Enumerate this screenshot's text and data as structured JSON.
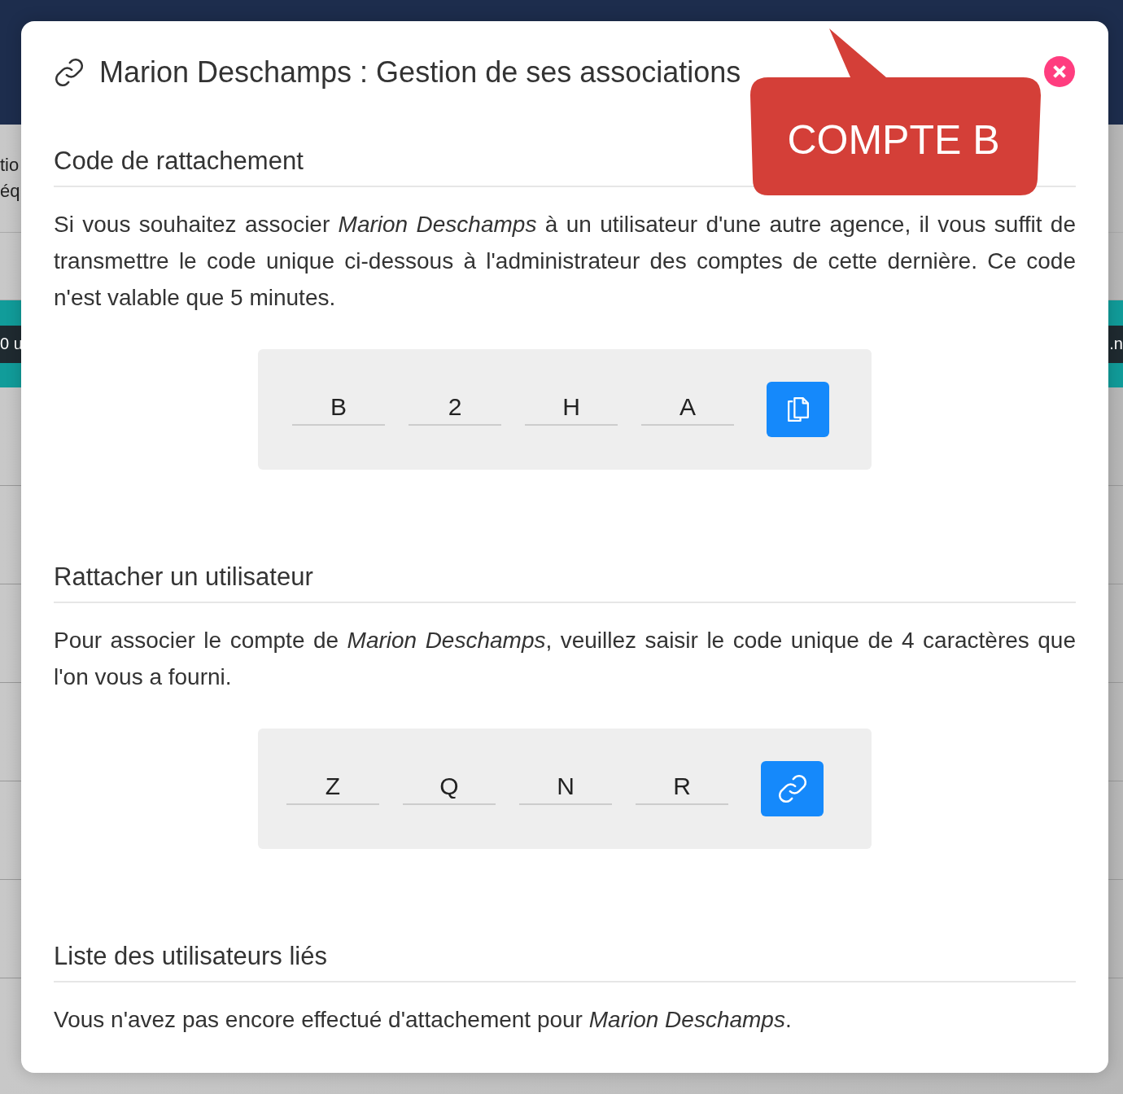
{
  "background_page": {
    "side_texts": [
      "tio",
      "éq"
    ],
    "bar_left_text": "0 u",
    "bar_right_text": ".n"
  },
  "modal": {
    "title": "Marion Deschamps : Gestion de ses associations",
    "close_button": {
      "kind": "close"
    },
    "callout": {
      "text": "COMPTE B"
    },
    "sections": [
      {
        "heading": "Code de rattachement",
        "paragraph": "Si vous souhaitez associer *Marion Deschamps* à un utilisateur d'une autre agence, il vous suffit de transmettre le code unique ci-dessous à l'administrateur des comptes de cette dernière. Ce code n'est valable que 5 minutes.",
        "code": {
          "kind": "display",
          "characters": [
            "B",
            "2",
            "H",
            "A"
          ],
          "button": {
            "kind": "copy"
          }
        }
      },
      {
        "heading": "Rattacher un utilisateur",
        "paragraph": "Pour associer le compte de *Marion Deschamps*, veuillez saisir le code unique de 4 caractères que l'on vous a fourni.",
        "code": {
          "kind": "input",
          "characters": [
            "Z",
            "Q",
            "N",
            "R"
          ],
          "button": {
            "kind": "link"
          }
        }
      },
      {
        "heading": "Liste des utilisateurs liés",
        "paragraph": "Vous n'avez pas encore effectué d'attachement pour *Marion Deschamps*."
      }
    ]
  }
}
